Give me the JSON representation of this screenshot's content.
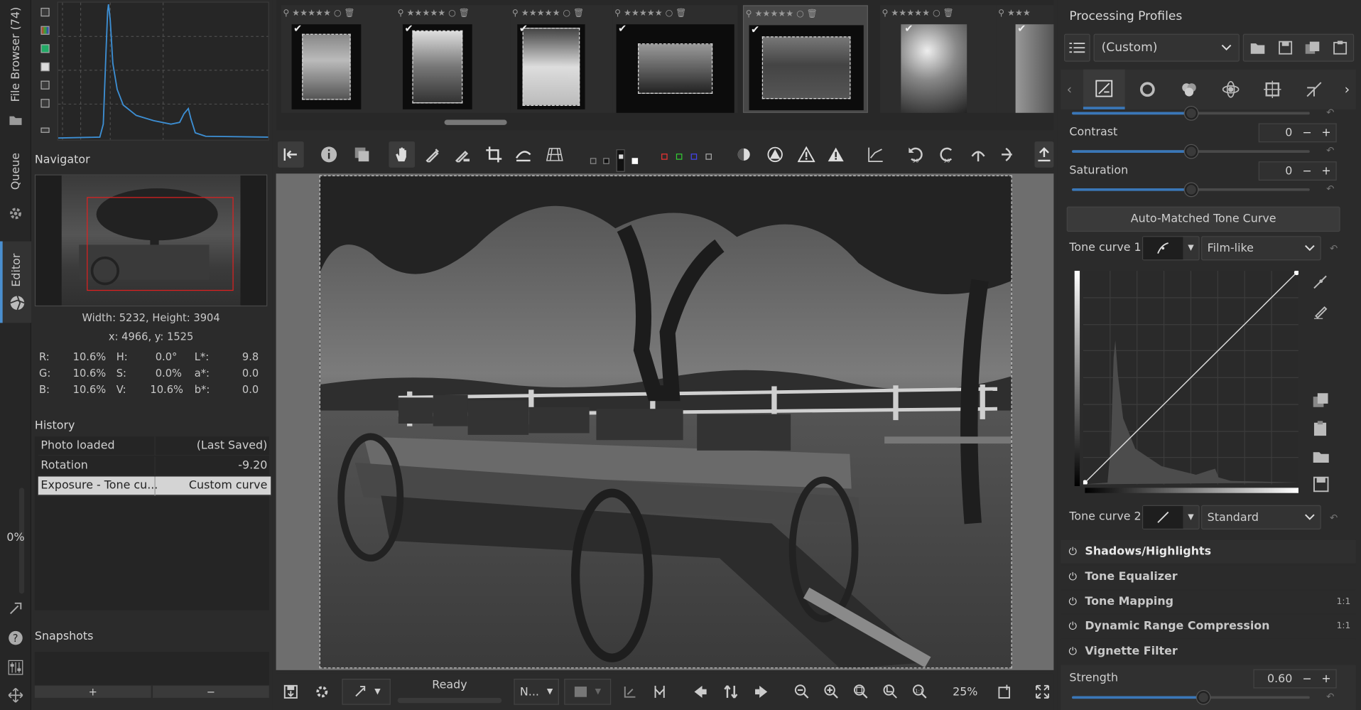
{
  "sidebar_tabs": {
    "file_browser": "File Browser (74)",
    "queue": "Queue",
    "editor": "Editor",
    "progress": "0%"
  },
  "left_panel": {
    "navigator_title": "Navigator",
    "dimensions": "Width: 5232, Height: 3904",
    "coords": "x: 4966, y: 1525",
    "pixel_info": {
      "r_label": "R:",
      "r_val": "10.6%",
      "g_label": "G:",
      "g_val": "10.6%",
      "b_label": "B:",
      "b_val": "10.6%",
      "h_label": "H:",
      "h_val": "0.0°",
      "s_label": "S:",
      "s_val": "0.0%",
      "v_label": "V:",
      "v_val": "10.6%",
      "l_label": "L*:",
      "l_val": "9.8",
      "a_label": "a*:",
      "a_val": "0.0",
      "bb_label": "b*:",
      "bb_val": "0.0"
    },
    "history_title": "History",
    "history": [
      {
        "action": "Photo loaded",
        "value": "(Last Saved)"
      },
      {
        "action": "Rotation",
        "value": "-9.20"
      },
      {
        "action": "Exposure - Tone cu...",
        "value": "Custom curve"
      }
    ],
    "snapshots_title": "Snapshots",
    "snap_add": "+",
    "snap_remove": "−"
  },
  "status": {
    "ready": "Ready",
    "zoom": "25%",
    "filter_select": "N..."
  },
  "right_panel": {
    "profiles_title": "Processing Profiles",
    "profile_value": "(Custom)",
    "contrast_label": "Contrast",
    "contrast_value": "0",
    "contrast_level": 0.5,
    "saturation_label": "Saturation",
    "saturation_value": "0",
    "saturation_level": 0.5,
    "top_slider_level": 0.5,
    "auto_button": "Auto-Matched Tone Curve",
    "tone_curve1_label": "Tone curve 1:",
    "tone_curve1_mode": "Film-like",
    "tone_curve2_label": "Tone curve 2:",
    "tone_curve2_mode": "Standard",
    "tools": [
      {
        "name": "Shadows/Highlights",
        "badge": ""
      },
      {
        "name": "Tone Equalizer",
        "badge": ""
      },
      {
        "name": "Tone Mapping",
        "badge": "1:1"
      },
      {
        "name": "Dynamic Range Compression",
        "badge": "1:1"
      },
      {
        "name": "Vignette Filter",
        "badge": ""
      }
    ],
    "strength_label": "Strength",
    "strength_value": "0.60",
    "strength_level": 0.55,
    "spin_minus": "−",
    "spin_plus": "+"
  },
  "icons": [
    "histogram-toolbar-icons",
    "folder-icon",
    "gear-icon",
    "camera-aperture-icon",
    "hand-icon",
    "crop-icon",
    "color-picker-icon",
    "info-icon",
    "warning-icon",
    "zoom-in-icon",
    "zoom-out-icon",
    "fullscreen-icon"
  ]
}
